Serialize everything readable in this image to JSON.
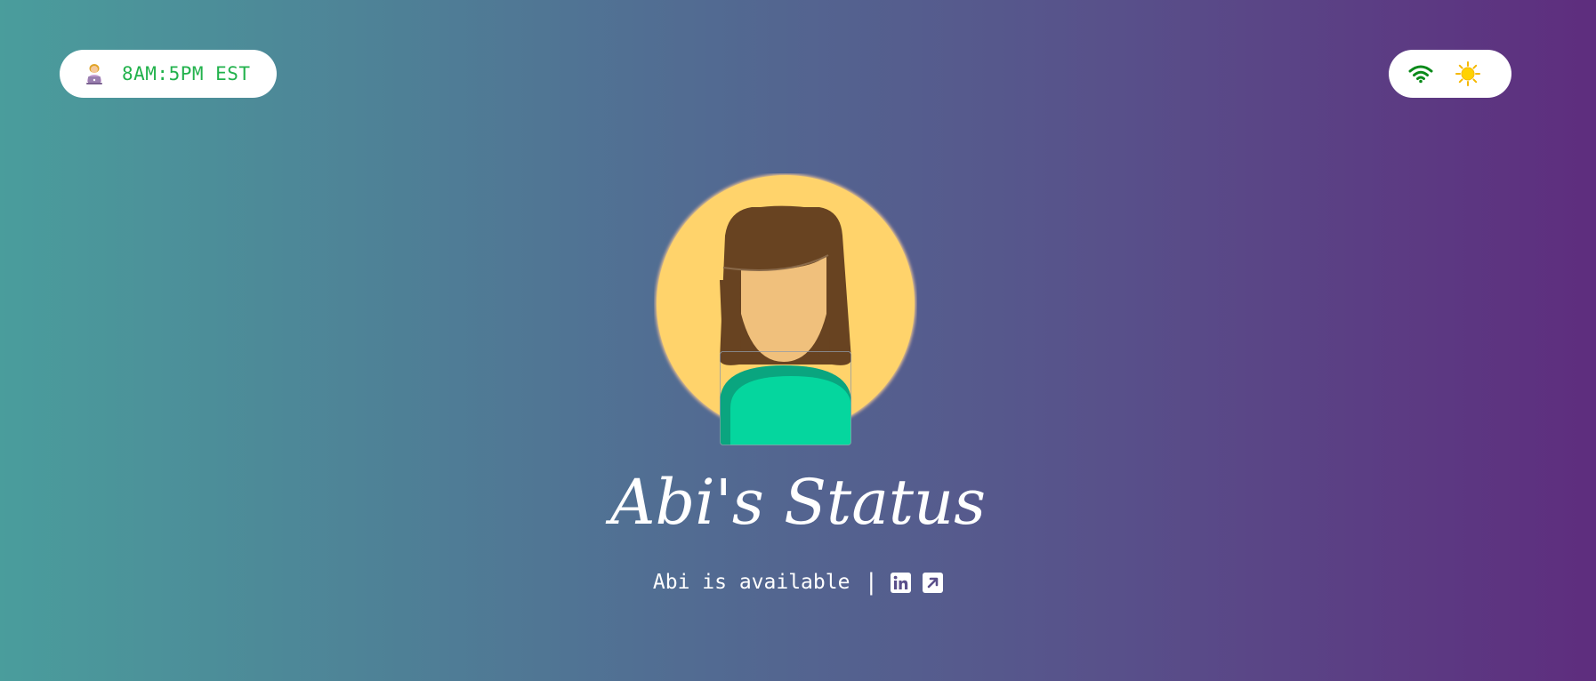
{
  "work_hours": {
    "icon": "woman-technologist-icon",
    "text": "8AM:5PM EST",
    "text_color": "#22b24c"
  },
  "status_indicators": {
    "connection_icon": "wifi-icon",
    "connection_color": "#0a8a1a",
    "daytime_icon": "sun-icon",
    "daytime_color": "#ffd200"
  },
  "profile": {
    "avatar_icon": "woman-avatar-icon",
    "title": "Abi's Status",
    "status_text": "Abi is available",
    "separator": "|",
    "links": [
      {
        "icon": "linkedin-icon"
      },
      {
        "icon": "external-link-icon"
      }
    ]
  },
  "colors": {
    "gradient_start": "#4a9d9c",
    "gradient_end": "#5e2d7e",
    "avatar_background": "#ffd36b",
    "hair": "#684321",
    "skin": "#f0c07c",
    "shirt": "#05d69e"
  }
}
